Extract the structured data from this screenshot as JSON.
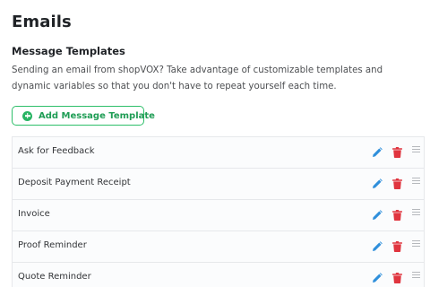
{
  "page": {
    "title": "Emails"
  },
  "section": {
    "title": "Message Templates",
    "description_lines": [
      "Sending an email from shopVOX? Take advantage of customizable templates and",
      "dynamic variables so that you don't have to repeat yourself each time."
    ]
  },
  "add_button": {
    "label": "Add Message Template",
    "icon": "plus-circle-icon"
  },
  "templates": [
    {
      "label": "Ask for Feedback"
    },
    {
      "label": "Deposit Payment Receipt"
    },
    {
      "label": "Invoice"
    },
    {
      "label": "Proof Reminder"
    },
    {
      "label": "Quote Reminder"
    }
  ],
  "row_actions": {
    "edit_icon": "pencil-icon",
    "delete_icon": "trash-icon",
    "drag_icon": "drag-handle-icon"
  },
  "colors": {
    "accent_green": "#28b463",
    "edit_blue": "#2f8fdb",
    "delete_red": "#e0353f",
    "drag_gray": "#b5b8bc"
  }
}
